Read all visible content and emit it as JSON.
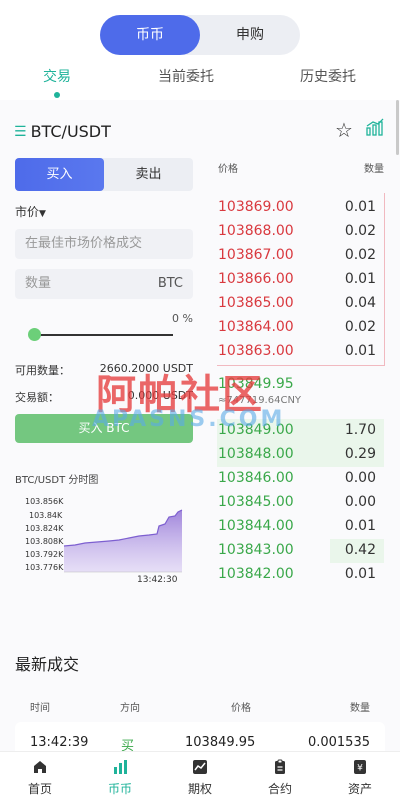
{
  "top_tabs": [
    "币币",
    "申购"
  ],
  "sub_tabs": [
    "交易",
    "当前委托",
    "历史委托"
  ],
  "pair": "BTC/USDT",
  "trade": {
    "buy_label": "买入",
    "sell_label": "卖出",
    "order_type": "市价",
    "price_placeholder": "在最佳市场价格成交",
    "qty_placeholder": "数量",
    "qty_unit": "BTC",
    "percent": "0 %",
    "available_label": "可用数量：",
    "available_value": "2660.2000 USDT",
    "amount_label": "交易额：",
    "amount_value": "0.000 USDT",
    "action_label": "买入 BTC"
  },
  "mini_chart": {
    "title": "BTC/USDT 分时图",
    "y_ticks": [
      "103.856K",
      "103.84K",
      "103.824K",
      "103.808K",
      "103.792K",
      "103.776K"
    ],
    "time": "13:42:30"
  },
  "orderbook": {
    "price_header": "价格",
    "qty_header": "数量",
    "asks": [
      {
        "price": "103869.00",
        "qty": "0.01"
      },
      {
        "price": "103868.00",
        "qty": "0.02"
      },
      {
        "price": "103867.00",
        "qty": "0.02"
      },
      {
        "price": "103866.00",
        "qty": "0.01"
      },
      {
        "price": "103865.00",
        "qty": "0.04"
      },
      {
        "price": "103864.00",
        "qty": "0.02"
      },
      {
        "price": "103863.00",
        "qty": "0.01"
      }
    ],
    "last_price": "103849.95",
    "last_cny": "≈747719.64CNY",
    "bids": [
      {
        "price": "103849.00",
        "qty": "1.70"
      },
      {
        "price": "103848.00",
        "qty": "0.29"
      },
      {
        "price": "103846.00",
        "qty": "0.00"
      },
      {
        "price": "103845.00",
        "qty": "0.00"
      },
      {
        "price": "103844.00",
        "qty": "0.01"
      },
      {
        "price": "103843.00",
        "qty": "0.42"
      },
      {
        "price": "103842.00",
        "qty": "0.01"
      }
    ]
  },
  "watermark": {
    "text_cn": "阿帕社区",
    "text_en": "APASNS.COM"
  },
  "latest_trades": {
    "title": "最新成交",
    "headers": [
      "时间",
      "方向",
      "价格",
      "数量"
    ],
    "rows": [
      {
        "time": "13:42:39",
        "side": "买",
        "price": "103849.95",
        "qty": "0.001535"
      }
    ]
  },
  "bottom_nav": [
    "首页",
    "币币",
    "期权",
    "合约",
    "资产"
  ],
  "colors": {
    "accent": "#4e6bea",
    "teal": "#1fb39a",
    "ask": "#d9393f",
    "bid": "#3aa84a",
    "buy_action": "#74c780"
  }
}
